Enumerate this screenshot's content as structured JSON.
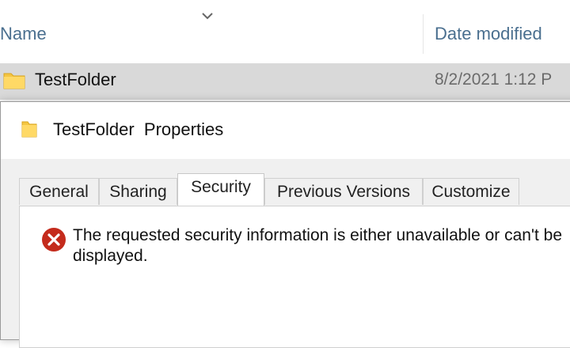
{
  "explorer": {
    "columns": {
      "name": "Name",
      "date_modified": "Date modified"
    },
    "rows": [
      {
        "name": "TestFolder",
        "date": "8/2/2021 1:12 P"
      }
    ]
  },
  "dialog": {
    "title": "TestFolder  Properties",
    "tabs": [
      {
        "label": "General"
      },
      {
        "label": "Sharing"
      },
      {
        "label": "Security",
        "active": true
      },
      {
        "label": "Previous Versions"
      },
      {
        "label": "Customize"
      }
    ],
    "error_message": "The requested security information is either unavailable or can't be displayed."
  },
  "colors": {
    "folder": "#f4c542",
    "error_red": "#c42b1c",
    "header_text": "#4a6f8f",
    "selected_row": "#d9d9d9"
  }
}
